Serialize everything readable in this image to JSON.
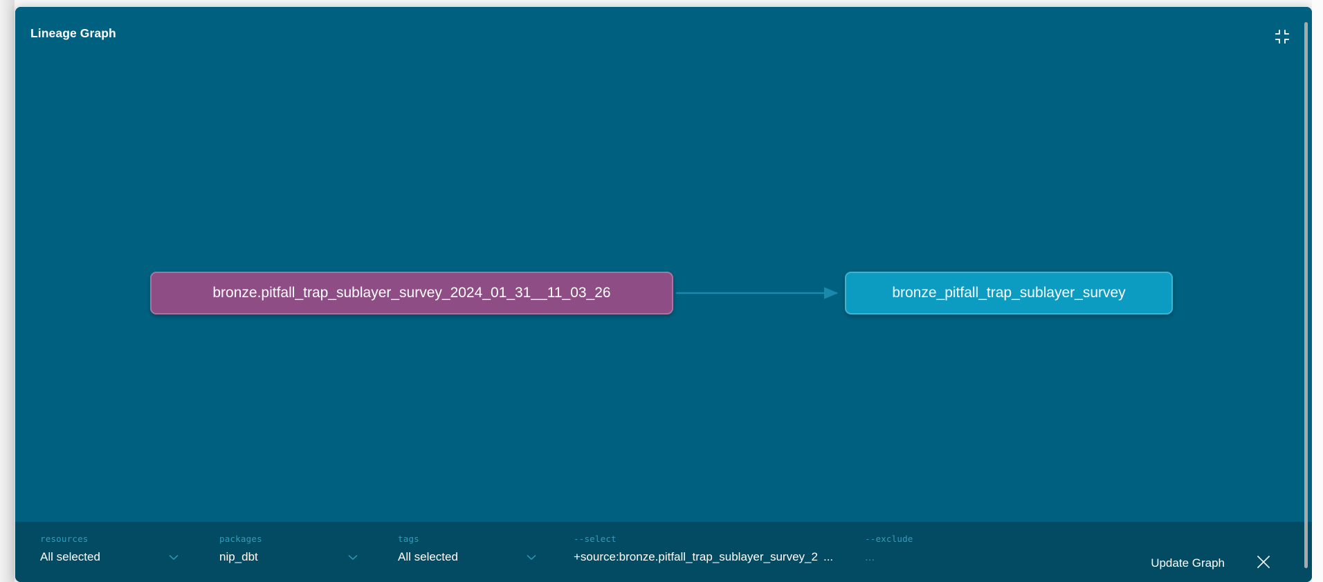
{
  "panel": {
    "title": "Lineage Graph",
    "collapse_icon": "collapse-arrows-icon",
    "close_icon": "close-x-icon",
    "colors": {
      "panel_bg": "#00607f",
      "control_bar_bg": "#034b62",
      "source_node_bg": "#8f4d85",
      "source_node_border": "#a776a0",
      "model_node_bg": "#0d9cc1",
      "model_node_border": "#3fb4d0",
      "edge": "#1a89ab",
      "label_text": "#2f9dba",
      "value_text": "#ffffff"
    }
  },
  "graph": {
    "nodes": [
      {
        "id": "source",
        "label": "bronze.pitfall_trap_sublayer_survey_2024_01_31__11_03_26",
        "type": "source"
      },
      {
        "id": "model",
        "label": "bronze_pitfall_trap_sublayer_survey",
        "type": "model"
      }
    ],
    "edges": [
      {
        "from": "source",
        "to": "model"
      }
    ]
  },
  "controls": {
    "resources": {
      "label": "resources",
      "value": "All selected",
      "chevron_icon": "chevron-down-icon"
    },
    "packages": {
      "label": "packages",
      "value": "nip_dbt",
      "chevron_icon": "chevron-down-icon"
    },
    "tags": {
      "label": "tags",
      "value": "All selected",
      "chevron_icon": "chevron-down-icon"
    },
    "select": {
      "label": "--select",
      "value": "+source:bronze.pitfall_trap_sublayer_survey_2",
      "overflow_indicator": "..."
    },
    "exclude": {
      "label": "--exclude",
      "placeholder": "...",
      "value": "..."
    },
    "update_button": "Update Graph"
  }
}
